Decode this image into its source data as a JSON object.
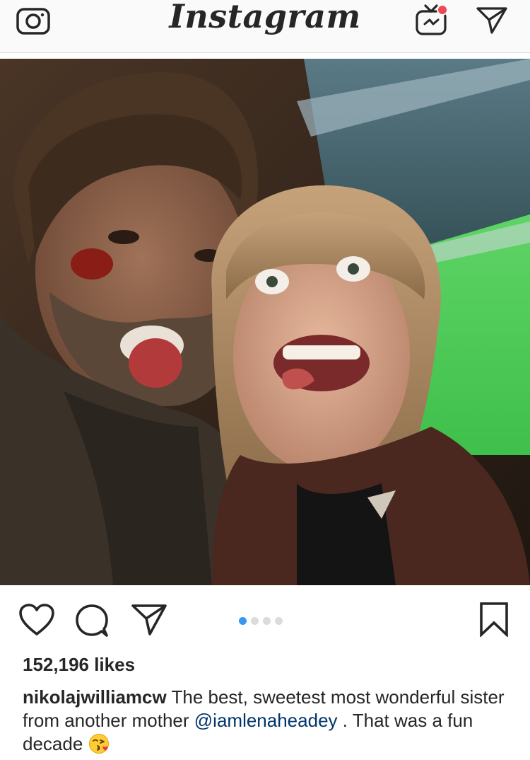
{
  "header": {
    "logo": "Instagram",
    "icons": [
      "camera-icon",
      "igtv-icon",
      "direct-message-icon"
    ],
    "notification_color": "#ed4956"
  },
  "post": {
    "photo_alt": "Selfie of two people making funny faces",
    "carousel": {
      "count": 4,
      "active_index": 0,
      "active_color": "#3897f0"
    },
    "actions": [
      "heart-icon",
      "comment-icon",
      "share-icon",
      "bookmark-icon"
    ],
    "likes": "152,196 likes",
    "caption": {
      "username": "nikolajwilliamcw",
      "text_1": " The best, sweetest most wonderful sister from another mother ",
      "mention": "@iamlenaheadey",
      "text_2": " .  That was a fun decade ",
      "emoji": "kissing-face-emoji"
    }
  }
}
